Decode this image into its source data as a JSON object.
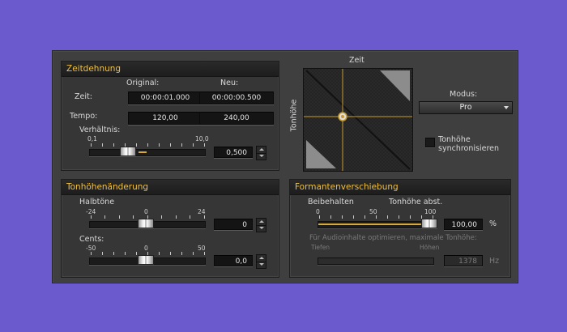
{
  "zeitdehnung": {
    "title": "Zeitdehnung",
    "col_original": "Original:",
    "col_neu": "Neu:",
    "zeit_label": "Zeit:",
    "zeit_original": "00:00:01.000",
    "zeit_neu": "00:00:00.500",
    "tempo_label": "Tempo:",
    "tempo_original": "120,00",
    "tempo_neu": "240,00",
    "verhaeltnis_label": "Verhältnis:",
    "slider_min": "0,1",
    "slider_max": "10,0",
    "slider_value": "0,500"
  },
  "pad": {
    "x_label": "Zeit",
    "y_label": "Tonhöhe"
  },
  "modus": {
    "label": "Modus:",
    "value": "Pro"
  },
  "sync": {
    "label_line1": "Tonhöhe",
    "label_line2": "synchronisieren"
  },
  "tonhoehe": {
    "title": "Tonhöhenänderung",
    "halbtoene_label": "Halbtöne",
    "halbtoene_min": "-24",
    "halbtoene_mid": "0",
    "halbtoene_max": "24",
    "halbtoene_value": "0",
    "cents_label": "Cents:",
    "cents_min": "-50",
    "cents_mid": "0",
    "cents_max": "50",
    "cents_value": "0,0"
  },
  "formant": {
    "title": "Formantenverschiebung",
    "beibehalten": "Beibehalten",
    "tonhoehe_abst": "Tonhöhe abst.",
    "scale_min": "0",
    "scale_mid": "50",
    "scale_max": "100",
    "value": "100,00",
    "unit": "%",
    "value_fraction": 1.0,
    "audio_label": "Für Audioinhalte optimieren, maximale Tonhöhe:",
    "tiefen": "Tiefen",
    "hoehen": "Höhen",
    "hz_value": "1378",
    "hz_unit": "Hz"
  }
}
